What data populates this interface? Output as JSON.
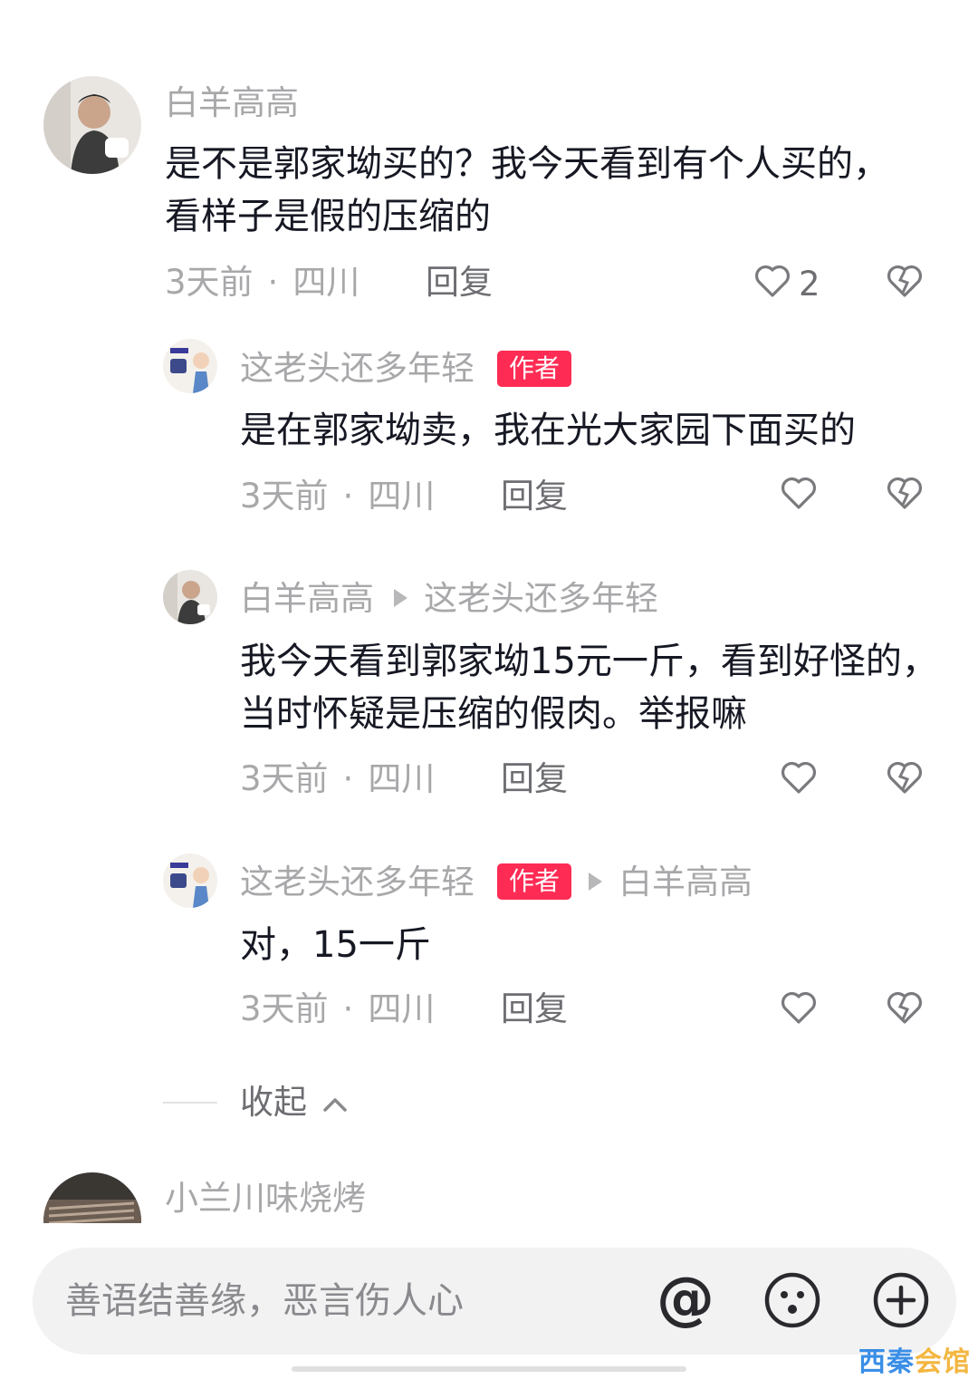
{
  "comments": [
    {
      "user": "白羊高高",
      "text": "是不是郭家坳买的？我今天看到有个人买的，看样子是假的压缩的",
      "time": "3天前",
      "location": "四川",
      "reply_label": "回复",
      "like_count": "2"
    },
    {
      "user": "这老头还多年轻",
      "badge": "作者",
      "text": "是在郭家坳卖，我在光大家园下面买的",
      "time": "3天前",
      "location": "四川",
      "reply_label": "回复"
    },
    {
      "user": "白羊高高",
      "reply_to": "这老头还多年轻",
      "text": "我今天看到郭家坳15元一斤，看到好怪的，当时怀疑是压缩的假肉。举报嘛",
      "time": "3天前",
      "location": "四川",
      "reply_label": "回复"
    },
    {
      "user": "这老头还多年轻",
      "badge": "作者",
      "reply_to": "白羊高高",
      "text": "对，15一斤",
      "time": "3天前",
      "location": "四川",
      "reply_label": "回复"
    }
  ],
  "collapse_label": "收起",
  "next_comment": {
    "user": "小兰川味烧烤"
  },
  "input": {
    "placeholder": "善语结善缘，恶言伤人心"
  },
  "watermark": {
    "part1": "西秦",
    "part2": "会馆"
  },
  "colors": {
    "author_badge": "#fe2c55",
    "name": "#a8a8ab",
    "text": "#161823"
  },
  "icons": [
    "heart-icon",
    "dislike-icon",
    "at-icon",
    "emoji-icon",
    "plus-icon"
  ]
}
